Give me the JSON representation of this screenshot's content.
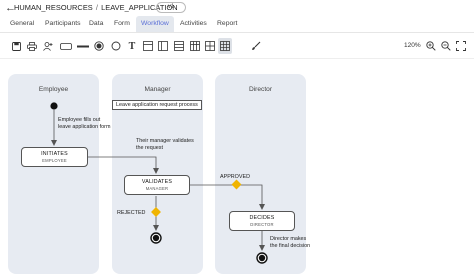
{
  "header": {
    "back_icon": "arrow-left-icon",
    "breadcrumb_root": "HUMAN_RESOURCES",
    "breadcrumb_sep": "/",
    "breadcrumb_leaf": "LEAVE_APPLICATION",
    "version": "v1"
  },
  "tabs": [
    "General",
    "Participants",
    "Data",
    "Form",
    "Workflow",
    "Activities",
    "Report"
  ],
  "active_tab": "Workflow",
  "toolbar": {
    "icons": [
      "save-icon",
      "print-icon",
      "add-participant-icon",
      "rectangle-icon",
      "line-icon",
      "circle-icon",
      "circle-outline-icon",
      "text-icon",
      "layout-vertical-icon",
      "layout-columns-icon",
      "layout-list-icon",
      "table-icon",
      "grid-icon",
      "brush-icon"
    ],
    "zoom_level": "120%",
    "zoom_icons": [
      "zoom-in-icon",
      "zoom-out-icon",
      "zoom-fit-icon"
    ]
  },
  "lanes": [
    "Employee",
    "Manager",
    "Director"
  ],
  "nodes": {
    "initiates": {
      "title": "INITIATES",
      "role": "EMPLOYEE"
    },
    "validates": {
      "title": "VALIDATES",
      "role": "MANAGER"
    },
    "decides": {
      "title": "DECIDES",
      "role": "DIRECTOR"
    }
  },
  "labels": {
    "employee_fills": [
      "Employee fills out",
      "leave application form"
    ],
    "process_note": "Leave application request process",
    "manager_validates": [
      "Their manager validates",
      "the request"
    ],
    "approved": "APPROVED",
    "rejected": "REJECTED",
    "director_makes": [
      "Director makes",
      "the final decision"
    ]
  },
  "colors": {
    "accent": "#5b6fd6",
    "lane_bg": "#e7ebf2",
    "gateway": "#f0b400",
    "edge": "#555555"
  }
}
